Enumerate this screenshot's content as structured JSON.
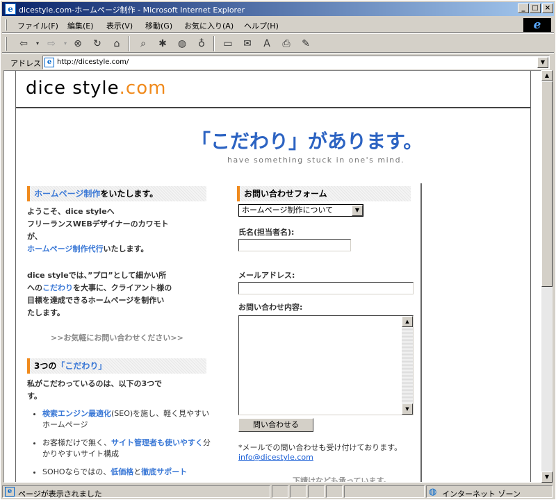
{
  "window": {
    "title": "dicestyle.com-ホームページ制作 - Microsoft Internet Explorer",
    "min": "_",
    "max": "□",
    "close": "×"
  },
  "menu": [
    "ファイル(F)",
    "編集(E)",
    "表示(V)",
    "移動(G)",
    "お気に入り(A)",
    "ヘルプ(H)"
  ],
  "address": {
    "label": "アドレス",
    "url": "http://dicestyle.com/"
  },
  "site": {
    "logo_main": "dice style",
    "logo_suffix": ".com",
    "catch": "「こだわり」があります。",
    "catch_sub": "have something stuck in one's mind."
  },
  "left": {
    "section1_link": "ホームページ制作",
    "section1_rest": "をいたします。",
    "intro1": "ようこそ、dice styleへ",
    "intro2": "フリーランスWEBデザイナーのカワモト",
    "intro3": "が、",
    "intro4_link": "ホームページ制作代行",
    "intro4_rest": "いたします。",
    "para_a": "dice styleでは、”プロ”として細かい所",
    "para_b1": "への",
    "para_b_link": "こだわり",
    "para_b2": "を大事に、クライアント様の",
    "para_c": "目標を達成できるホームページを制作い",
    "para_d": "たします。",
    "contact_link": ">>お気軽にお問い合わせください>>",
    "section2_pre": "3つの",
    "section2_link": "「こだわり」",
    "section2_desc1": "私がこだわっているのは、以下の3つで",
    "section2_desc2": "す。",
    "bullets": [
      {
        "pre": "",
        "link": "検索エンジン最適化",
        "post": "(SEO)を施し、軽く見やすいホームページ"
      },
      {
        "pre": "お客様だけで無く、",
        "link": "サイト管理者も使いやすく",
        "post": "分かりやすいサイト構成"
      },
      {
        "pre": "SOHOならではの、",
        "link": "低価格",
        "post": "と",
        "link2": "徹底サポート"
      }
    ]
  },
  "form": {
    "heading": "お問い合わせフォーム",
    "select_value": "ホームページ制作について",
    "name_label": "氏名(担当者名):",
    "email_label": "メールアドレス:",
    "content_label": "お問い合わせ内容:",
    "submit": "問い合わせる",
    "note": "*メールでの問い合わせも受け付けております。",
    "email": "info@dicestyle.com",
    "footer_partial": "下請けなども承っています。"
  },
  "status": {
    "text": "ページが表示されました",
    "zone": "インターネット ゾーン"
  },
  "colors": {
    "accent": "#f08a1c",
    "link": "#3a78d6",
    "catch": "#2c63c2"
  }
}
